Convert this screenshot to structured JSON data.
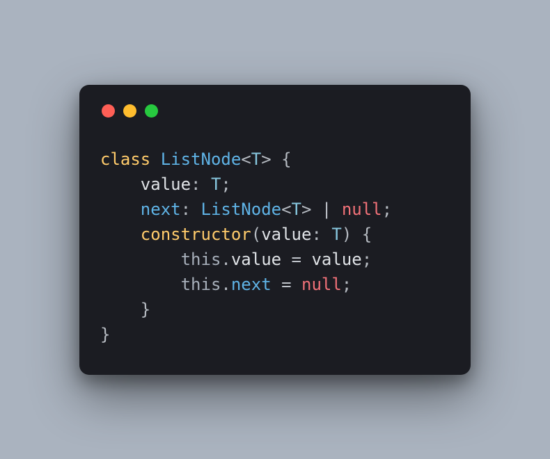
{
  "window": {
    "controls": [
      "close",
      "minimize",
      "zoom"
    ]
  },
  "code": {
    "language": "typescript",
    "lines": [
      [
        {
          "t": "class ",
          "c": "tok-kw"
        },
        {
          "t": "ListNode",
          "c": "tok-type"
        },
        {
          "t": "<",
          "c": "tok-punc"
        },
        {
          "t": "T",
          "c": "tok-param"
        },
        {
          "t": ">",
          "c": "tok-punc"
        },
        {
          "t": " {",
          "c": "tok-punc"
        }
      ],
      [
        {
          "t": "    ",
          "c": ""
        },
        {
          "t": "value",
          "c": "tok-prop"
        },
        {
          "t": ": ",
          "c": "tok-punc"
        },
        {
          "t": "T",
          "c": "tok-param"
        },
        {
          "t": ";",
          "c": "tok-punc"
        }
      ],
      [
        {
          "t": "    ",
          "c": ""
        },
        {
          "t": "next",
          "c": "tok-type"
        },
        {
          "t": ": ",
          "c": "tok-punc"
        },
        {
          "t": "ListNode",
          "c": "tok-type"
        },
        {
          "t": "<",
          "c": "tok-punc"
        },
        {
          "t": "T",
          "c": "tok-param"
        },
        {
          "t": ">",
          "c": "tok-punc"
        },
        {
          "t": " | ",
          "c": "tok-op"
        },
        {
          "t": "null",
          "c": "tok-null"
        },
        {
          "t": ";",
          "c": "tok-punc"
        }
      ],
      [
        {
          "t": "    ",
          "c": ""
        },
        {
          "t": "constructor",
          "c": "tok-kw"
        },
        {
          "t": "(",
          "c": "tok-punc"
        },
        {
          "t": "value",
          "c": "tok-prop"
        },
        {
          "t": ": ",
          "c": "tok-punc"
        },
        {
          "t": "T",
          "c": "tok-param"
        },
        {
          "t": ")",
          "c": "tok-punc"
        },
        {
          "t": " {",
          "c": "tok-punc"
        }
      ],
      [
        {
          "t": "        ",
          "c": ""
        },
        {
          "t": "this",
          "c": "tok-this"
        },
        {
          "t": ".",
          "c": "tok-punc"
        },
        {
          "t": "value",
          "c": "tok-prop"
        },
        {
          "t": " = ",
          "c": "tok-op"
        },
        {
          "t": "value",
          "c": "tok-prop"
        },
        {
          "t": ";",
          "c": "tok-punc"
        }
      ],
      [
        {
          "t": "        ",
          "c": ""
        },
        {
          "t": "this",
          "c": "tok-this"
        },
        {
          "t": ".",
          "c": "tok-punc"
        },
        {
          "t": "next",
          "c": "tok-type"
        },
        {
          "t": " = ",
          "c": "tok-op"
        },
        {
          "t": "null",
          "c": "tok-null"
        },
        {
          "t": ";",
          "c": "tok-punc"
        }
      ],
      [
        {
          "t": "    }",
          "c": "tok-punc"
        }
      ],
      [
        {
          "t": "}",
          "c": "tok-punc"
        }
      ]
    ]
  }
}
